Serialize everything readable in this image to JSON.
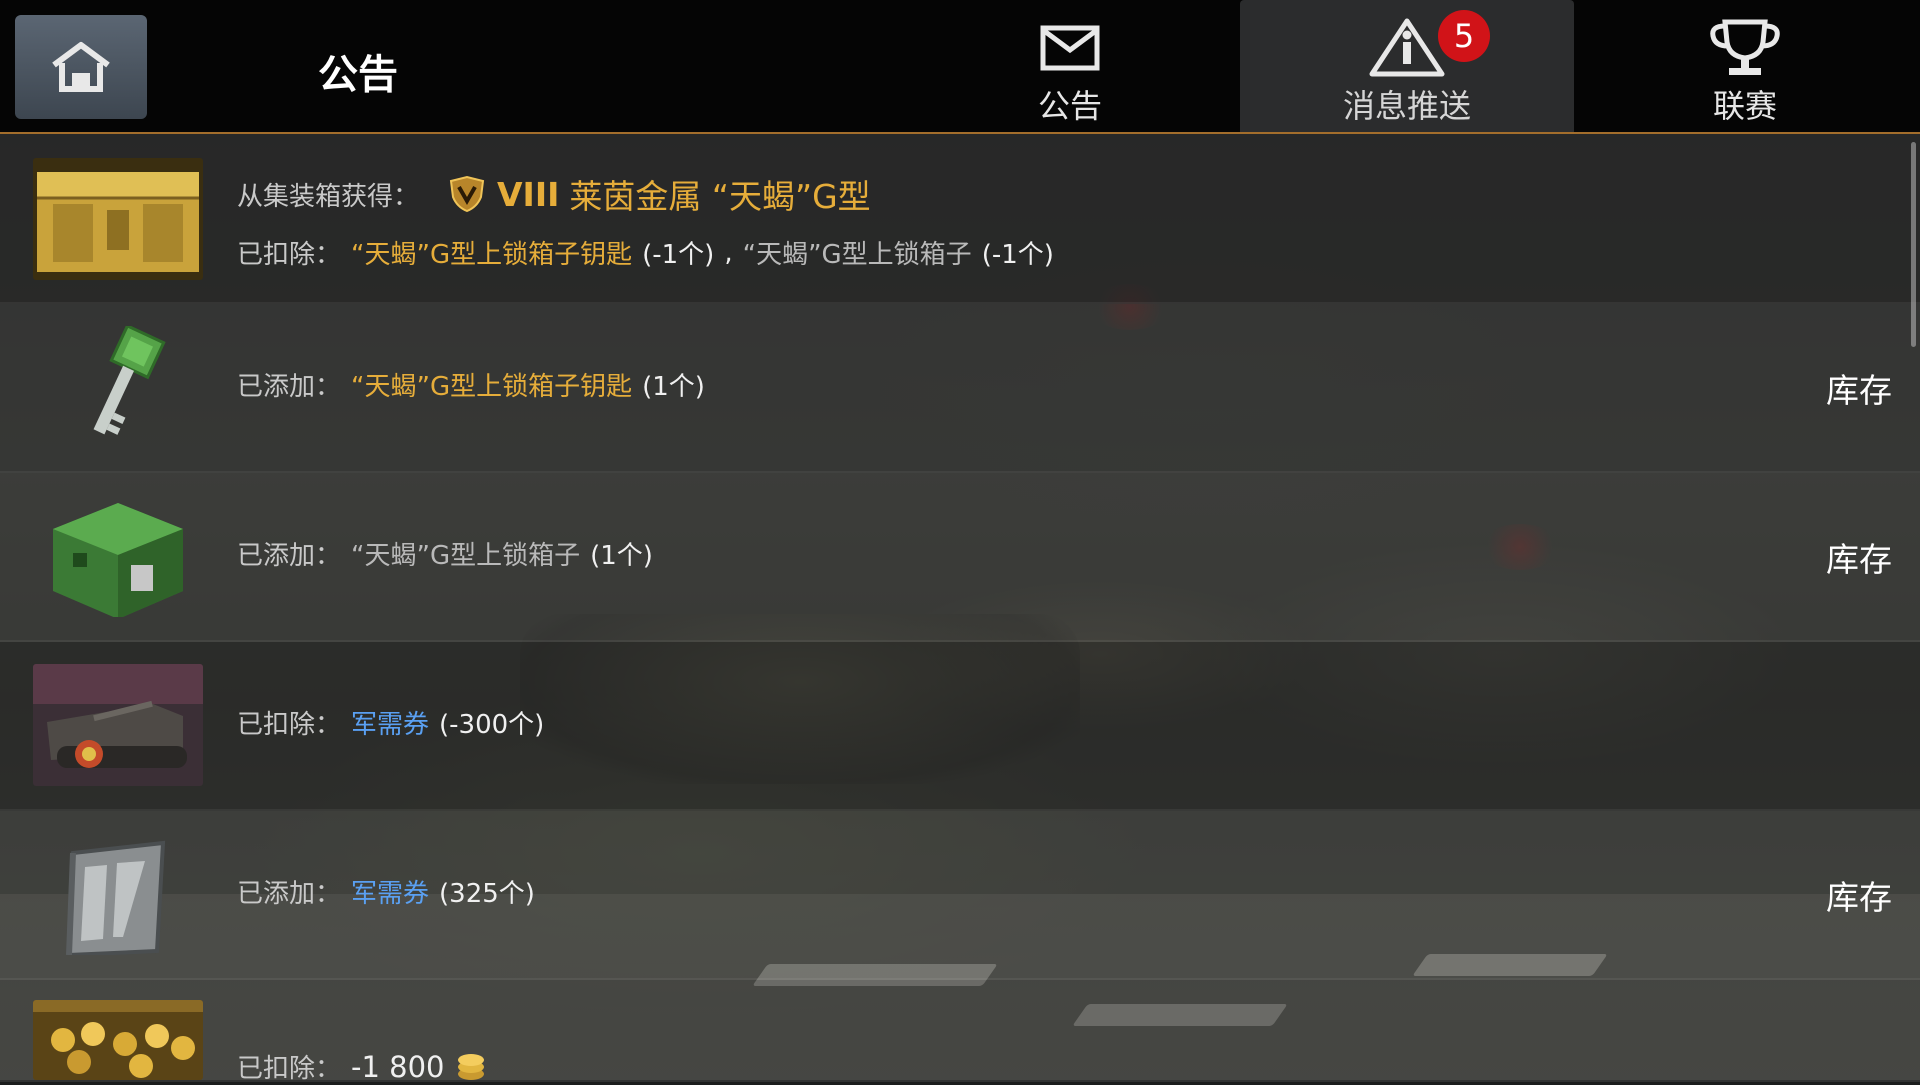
{
  "header": {
    "title": "公告",
    "tabs": [
      {
        "label": "公告",
        "icon": "envelope-icon"
      },
      {
        "label": "消息推送",
        "icon": "warning-icon",
        "badge": "5",
        "active": true
      },
      {
        "label": "联赛",
        "icon": "trophy-icon"
      }
    ]
  },
  "colors": {
    "accent_line": "#a36e2c",
    "gold": "#e6ad3a",
    "blue": "#5aa0f2",
    "badge": "#d11318"
  },
  "items": [
    {
      "line1": {
        "prefix": "从集装箱获得：",
        "tier": "VIII",
        "name": "莱茵金属 “天蝎”G型"
      },
      "line2": {
        "prefix": "已扣除：",
        "item1": "“天蝎”G型上锁箱子钥匙",
        "qty1": "(-1个)",
        "sep": ",",
        "item2": "“天蝎”G型上锁箱子",
        "qty2": "(-1个)"
      }
    },
    {
      "prefix": "已添加：",
      "item": "“天蝎”G型上锁箱子钥匙",
      "qty": "(1个)",
      "action": "库存"
    },
    {
      "prefix": "已添加：",
      "item": "“天蝎”G型上锁箱子",
      "qty": "(1个)",
      "action": "库存"
    },
    {
      "prefix": "已扣除：",
      "item": "军需券",
      "qty": "(-300个)"
    },
    {
      "prefix": "已添加：",
      "item": "军需券",
      "qty": "(325个)",
      "action": "库存"
    },
    {
      "prefix": "已扣除：",
      "amount": "-1 800",
      "icon": "gold-coins-icon"
    }
  ]
}
